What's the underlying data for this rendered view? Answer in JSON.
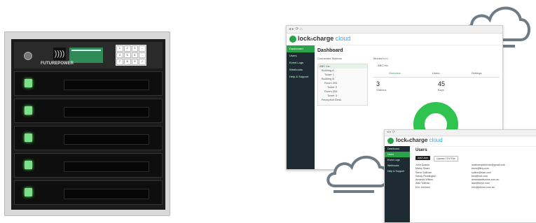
{
  "locker": {
    "brand": "FUTUREPOWER",
    "nfc_symbol": "))))",
    "keypad": [
      "1",
      "2",
      "3",
      "←",
      "4",
      "5",
      "6",
      "→",
      "7",
      "8",
      "9",
      "✓"
    ],
    "door_count": 5
  },
  "dashboard": {
    "logo_main": "lock",
    "logo_n": "n",
    "logo_charge": "charge",
    "logo_cloud": "cloud",
    "url": "",
    "sidebar": [
      "Dashboard",
      "Users",
      "Event Logs",
      "Webhooks",
      "Help & Support"
    ],
    "title": "Dashboard",
    "connected_label": "Connected Stations",
    "monitor_label": "Monitor's In",
    "tree": [
      "ABC Inc.",
      "Building A",
      "Tower 1",
      "Building B",
      "Room 204",
      "Tower 2",
      "Room 206",
      "Tower 3",
      "Reception Desk"
    ],
    "org": "ABC Inc.",
    "tabs": [
      "Overview",
      "Users",
      "Settings"
    ],
    "stats": [
      {
        "value": "3",
        "label": "Stations"
      },
      {
        "value": "45",
        "label": "Bays"
      }
    ],
    "colors": {
      "accent": "#2aa34a",
      "sidebar": "#1e2b33",
      "donut": "#2fc44f"
    }
  },
  "users_window": {
    "sidebar": [
      "Dashboard",
      "Users",
      "Event Logs",
      "Webhooks",
      "Help & Support"
    ],
    "title": "Users",
    "add_button": "Add User",
    "upload_button": "Upload CSV File",
    "names": [
      "John Doanin",
      "Marky Sharo",
      "Steve Sullivan",
      "Sandy Peddington",
      "Amanda Wilson",
      "Alan Tollman",
      "Eric Johnson"
    ],
    "emails": [
      "mattcampbell.info@gmail.com",
      "bmrs@lfny.com",
      "sullive@lvan.com",
      "bsd@lmd.com",
      "amandawilsonss.com.au",
      "alan@lmyn.com",
      "eric@johnsn.com.au"
    ]
  }
}
